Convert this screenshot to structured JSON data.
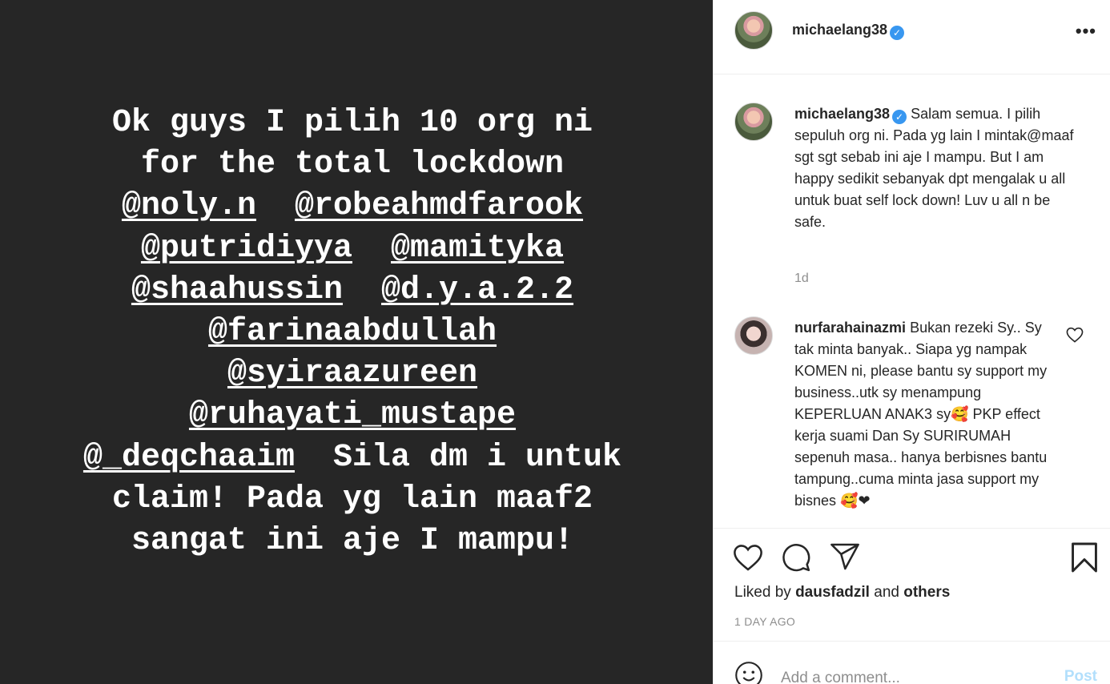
{
  "story": {
    "lines": [
      [
        "Ok guys I pilih 10 org ni"
      ],
      [
        "for the total lockdown"
      ],
      [
        "@noly.n",
        "  ",
        "@robeahmdfarook"
      ],
      [
        "@putridiyya",
        "  ",
        "@mamityka"
      ],
      [
        "@shaahussin",
        "  ",
        "@d.y.a.2.2"
      ],
      [
        "@farinaabdullah"
      ],
      [
        "@syiraazureen"
      ],
      [
        "@ruhayati_mustape"
      ],
      [
        "@_deqchaaim",
        "  Sila dm i untuk"
      ],
      [
        "claim! Pada yg lain maaf2"
      ],
      [
        "sangat ini aje I mampu!"
      ]
    ]
  },
  "header": {
    "username": "michaelang38",
    "verified_mark": "✓",
    "more_icon": "•••"
  },
  "caption": {
    "username": "michaelang38",
    "text": "Salam semua. I pilih sepuluh org ni. Pada yg lain I mintak@maaf sgt sgt sebab ini aje I mampu. But I am happy sedikit sebanyak dpt mengalak u all untuk buat self lock down! Luv u all n be safe.",
    "age": "1d"
  },
  "comment": {
    "username": "nurfarahainazmi",
    "text": "Bukan rezeki Sy.. Sy tak minta banyak.. Siapa yg nampak KOMEN ni, please bantu sy support my business..utk sy menampung KEPERLUAN ANAK3 sy🥰 PKP effect kerja suami Dan Sy SURIRUMAH sepenuh masa.. hanya berbisnes bantu tampung..cuma minta jasa support my bisnes 🥰❤"
  },
  "actions": {
    "liked_prefix": "Liked by",
    "liked_user": "dausfadzil",
    "liked_and": "and",
    "liked_others": "others",
    "date": "1 DAY AGO"
  },
  "add_comment": {
    "placeholder": "Add a comment...",
    "post_label": "Post",
    "emoji_icon": "emoji-icon"
  },
  "colors": {
    "media_bg": "#262626",
    "verified": "#3897f0",
    "post_disabled": "#b2dffc",
    "muted": "#8e8e8e"
  }
}
